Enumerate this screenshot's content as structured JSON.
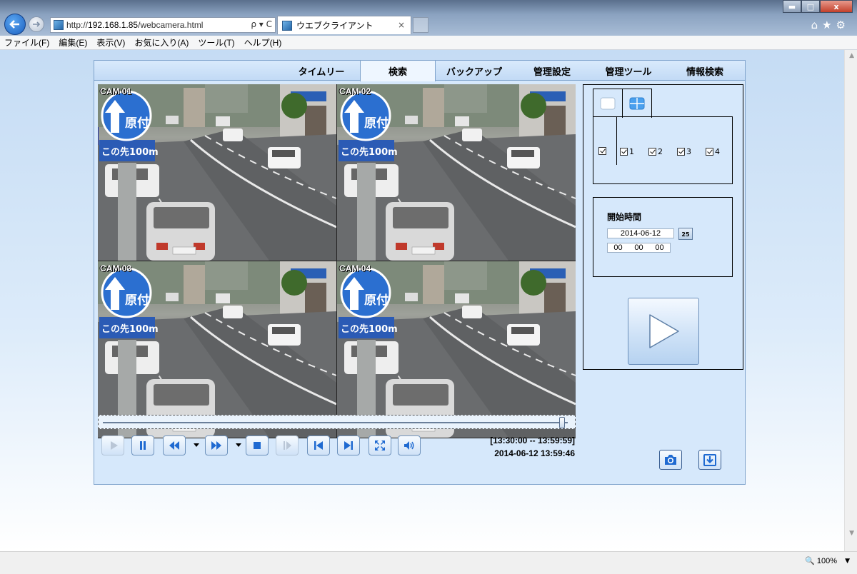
{
  "browser": {
    "url_prefix": "http://",
    "url_host": "192.168.1.85",
    "url_path": "/webcamera.html",
    "tab_title": "ウエブクライアント",
    "address_tools": "ρ ▾ C",
    "tab_close": "×",
    "win_min": "▬",
    "win_max": "□",
    "win_close": "x",
    "right_icons": "⌂★⚙",
    "zoom": "100%"
  },
  "menu": [
    "ファイル(F)",
    "編集(E)",
    "表示(V)",
    "お気に入り(A)",
    "ツール(T)",
    "ヘルプ(H)"
  ],
  "tabs": [
    {
      "label": "タイムリー",
      "active": false
    },
    {
      "label": "検索",
      "active": true
    },
    {
      "label": "バックアップ",
      "active": false
    },
    {
      "label": "管理設定",
      "active": false
    },
    {
      "label": "管理ツール",
      "active": false
    },
    {
      "label": "情報検索",
      "active": false
    }
  ],
  "cameras": [
    {
      "label": "CAM 01",
      "selected": true
    },
    {
      "label": "CAM 02",
      "selected": false
    },
    {
      "label": "CAM 03",
      "selected": false
    },
    {
      "label": "CAM 04",
      "selected": false
    }
  ],
  "sign": {
    "top": "原付",
    "bottom": "この先100m"
  },
  "seek": {
    "position": 0.985
  },
  "controls": [
    {
      "name": "play-button",
      "icon": "play-icon",
      "enabled": false
    },
    {
      "name": "pause-button",
      "icon": "pause-icon",
      "enabled": true
    },
    {
      "name": "rewind-button",
      "icon": "rewind-icon",
      "enabled": true
    },
    {
      "name": "fast-forward-button",
      "icon": "fast-forward-icon",
      "enabled": true
    },
    {
      "name": "stop-button",
      "icon": "stop-icon",
      "enabled": true
    },
    {
      "name": "step-forward-button",
      "icon": "step-forward-icon",
      "enabled": false
    },
    {
      "name": "skip-start-button",
      "icon": "skip-start-icon",
      "enabled": true
    },
    {
      "name": "skip-end-button",
      "icon": "skip-end-icon",
      "enabled": true
    },
    {
      "name": "fullscreen-button",
      "icon": "fullscreen-icon",
      "enabled": true
    },
    {
      "name": "audio-button",
      "icon": "speaker-icon",
      "enabled": true
    }
  ],
  "time_range": "[13:30:00 -- 13:59:59]",
  "current_time": "2014-06-12 13:59:46",
  "channels": {
    "all_checked": true,
    "items": [
      {
        "label": "1",
        "checked": true
      },
      {
        "label": "2",
        "checked": true
      },
      {
        "label": "3",
        "checked": true
      },
      {
        "label": "4",
        "checked": true
      }
    ]
  },
  "start": {
    "title": "開始時間",
    "date": "2014-06-12",
    "calendar_day": "25",
    "hour": "00",
    "minute": "00",
    "second": "00"
  },
  "colors": {
    "accent": "#1f6fd0",
    "icon_blue": "#1f6ad1"
  }
}
